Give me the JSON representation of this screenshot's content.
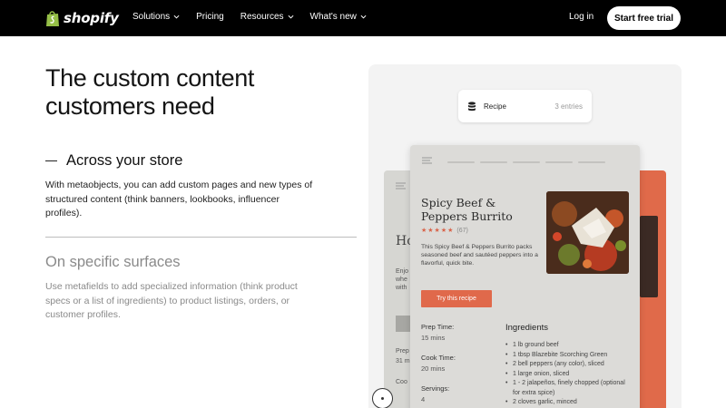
{
  "nav": {
    "logo_text": "shopify",
    "links": [
      {
        "label": "Solutions",
        "has_dropdown": true
      },
      {
        "label": "Pricing",
        "has_dropdown": false
      },
      {
        "label": "Resources",
        "has_dropdown": true
      },
      {
        "label": "What's new",
        "has_dropdown": true
      }
    ],
    "login": "Log in",
    "cta": "Start free trial"
  },
  "hero": {
    "title": "The custom content customers need"
  },
  "section1": {
    "title": "Across your store",
    "body": "With metaobjects, you can add custom pages and new types of structured content (think banners, lookbooks, influencer profiles)."
  },
  "section2": {
    "title": "On specific surfaces",
    "body": "Use metafields to add specialized information (think product specs or a list of ingredients) to product listings, orders, or customer profiles."
  },
  "visual": {
    "pill": {
      "label": "Recipe",
      "count": "3 entries",
      "icon": "database-icon"
    },
    "back_left": {
      "title": "Ho",
      "lines": [
        "Enjo",
        "whe",
        "with"
      ],
      "meta": [
        "Prep",
        "31 m",
        "Coo"
      ]
    },
    "recipe": {
      "title": "Spicy Beef & Peppers Burrito",
      "stars": "★★★★★",
      "rating": "(67)",
      "description": "This Spicy Beef & Peppers Burrito packs seasoned beef and sautéed peppers into a flavorful, quick bite.",
      "button": "Try this recipe",
      "prep_label": "Prep Time:",
      "prep_value": "15 mins",
      "cook_label": "Cook Time:",
      "cook_value": "20 mins",
      "servings_label": "Servings:",
      "servings_value": "4",
      "ingredients_title": "Ingredients",
      "ingredients": [
        "1 lb ground beef",
        "1 tbsp Blazebite Scorching Green",
        "2 bell peppers (any color), sliced",
        "1 large onion, sliced",
        "1 - 2 jalapeños, finely chopped (optional for extra spice)",
        "2 cloves garlic, minced"
      ]
    },
    "colors": {
      "accent": "#e0694b",
      "panel": "#f3f3f3",
      "card": "#dcdbd8"
    }
  }
}
